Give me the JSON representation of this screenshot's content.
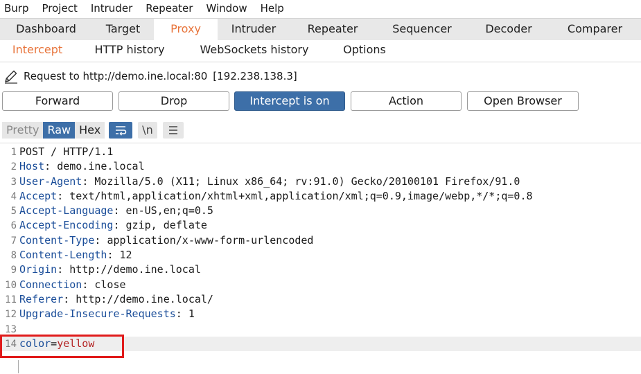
{
  "menubar": [
    "Burp",
    "Project",
    "Intruder",
    "Repeater",
    "Window",
    "Help"
  ],
  "main_tabs": [
    "Dashboard",
    "Target",
    "Proxy",
    "Intruder",
    "Repeater",
    "Sequencer",
    "Decoder",
    "Comparer"
  ],
  "proxy_tabs": [
    "Intercept",
    "HTTP history",
    "WebSockets history",
    "Options"
  ],
  "request": {
    "label": "Request to http://demo.ine.local:80",
    "ip": "[192.238.138.3]"
  },
  "buttons": {
    "forward": "Forward",
    "drop": "Drop",
    "intercept": "Intercept is on",
    "action": "Action",
    "open_browser": "Open Browser"
  },
  "view_modes": {
    "pretty": "Pretty",
    "raw": "Raw",
    "hex": "Hex",
    "newline": "\\n"
  },
  "editor": {
    "lines": [
      {
        "num": "1",
        "text": "POST / HTTP/1.1"
      },
      {
        "num": "2",
        "key": "Host",
        "sep": ": ",
        "val": "demo.ine.local"
      },
      {
        "num": "3",
        "key": "User-Agent",
        "sep": ": ",
        "val": "Mozilla/5.0 (X11; Linux x86_64; rv:91.0) Gecko/20100101 Firefox/91.0"
      },
      {
        "num": "4",
        "key": "Accept",
        "sep": ": ",
        "val": "text/html,application/xhtml+xml,application/xml;q=0.9,image/webp,*/*;q=0.8"
      },
      {
        "num": "5",
        "key": "Accept-Language",
        "sep": ": ",
        "val": "en-US,en;q=0.5"
      },
      {
        "num": "6",
        "key": "Accept-Encoding",
        "sep": ": ",
        "val": "gzip, deflate"
      },
      {
        "num": "7",
        "key": "Content-Type",
        "sep": ": ",
        "val": "application/x-www-form-urlencoded"
      },
      {
        "num": "8",
        "key": "Content-Length",
        "sep": ": ",
        "val": "12"
      },
      {
        "num": "9",
        "key": "Origin",
        "sep": ": ",
        "val": "http://demo.ine.local"
      },
      {
        "num": "10",
        "key": "Connection",
        "sep": ": ",
        "val": "close"
      },
      {
        "num": "11",
        "key": "Referer",
        "sep": ": ",
        "val": "http://demo.ine.local/"
      },
      {
        "num": "12",
        "key": "Upgrade-Insecure-Requests",
        "sep": ": ",
        "val": "1"
      },
      {
        "num": "13",
        "text": ""
      },
      {
        "num": "14",
        "param_key": "color",
        "param_eq": "=",
        "param_val": "yellow"
      }
    ]
  },
  "colors": {
    "accent": "#e8743b",
    "button_primary": "#3d6fa8",
    "header_key": "#1a4d99",
    "param_value": "#b32222",
    "highlight_box": "#e01b1b"
  }
}
